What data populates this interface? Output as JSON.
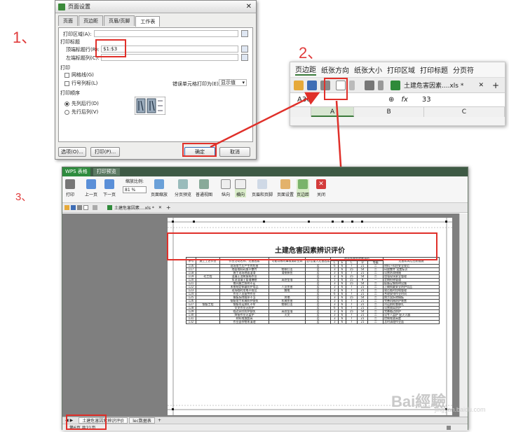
{
  "steps": {
    "s1": "1、",
    "s2": "2、",
    "s3": "3、"
  },
  "dialog": {
    "title": "页面设置",
    "tabs": [
      "页面",
      "页边距",
      "页眉/页脚",
      "工作表"
    ],
    "print_area_label": "打印区域(A):",
    "print_titles_label": "打印标题",
    "top_rows_label": "顶端标题行(R):",
    "top_rows_value": "$1:$3",
    "left_cols_label": "左端标题列(C):",
    "print_section": "打印",
    "gridlines_label": "网格线(G)",
    "rowcol_label": "行号列标(L)",
    "error_label": "错误单元格打印为(E):",
    "error_value": "显示值",
    "order_section": "打印顺序",
    "order_down": "先列后行(D)",
    "order_over": "先行后列(V)",
    "options_btn": "选项(O)...",
    "print_btn": "打印(P)...",
    "ok_btn": "确定",
    "cancel_btn": "取消"
  },
  "toolbar2": {
    "menu": [
      "页边距",
      "纸张方向",
      "纸张大小",
      "打印区域",
      "打印标题",
      "分页符"
    ],
    "doc_tab": "土建危害因素....xls *",
    "cell_ref": "A36",
    "fx": "fx",
    "cell_value": "33",
    "cols": [
      "",
      "A",
      "B",
      "C"
    ]
  },
  "wps": {
    "logo": "WPS 表格",
    "window_tab": "打印预览",
    "ribbon": [
      "打印",
      "上一页",
      "下一页",
      "缩放比例:",
      "页面缩放",
      "分页预览",
      "普通视图",
      "纵向",
      "横向",
      "页眉和页脚",
      "页面设置",
      "页边距",
      "关闭"
    ],
    "zoom": "81 %",
    "doc_tab": "土建危害因素....xls *",
    "sheet_tabs": [
      "土建危害因素辨识评价",
      "lec数据表"
    ],
    "status": "第6页 共21页"
  },
  "report": {
    "title": "土建危害因素辨识评价",
    "headers": [
      "序号",
      "施工工艺作业",
      "作业活动名称、危害因素",
      "可能导致的事故或职业病",
      "是/否重大危害因素",
      "作业条件危险性评价",
      "危害和风险控制措施"
    ],
    "sub_headers": [
      "L",
      "E",
      "C",
      "D",
      "等级"
    ],
    "rows": [
      {
        "n": "116",
        "b": "",
        "c": "现场加工后产生的危害",
        "d": "",
        "e": "否",
        "v": [
          "6",
          "6",
          "7",
          "21",
          "二"
        ],
        "g": "材料下料应安全规范"
      },
      {
        "n": "117",
        "b": "",
        "c": "地面堆料码放不整齐",
        "d": "物体打击",
        "e": "否",
        "v": [
          "3",
          "6",
          "15",
          "54",
          "二"
        ],
        "g": "码放整齐 设置标识"
      },
      {
        "n": "118",
        "b": "",
        "c": "施工现场地面湿滑",
        "d": "滑倒摔伤",
        "e": "否",
        "v": [
          "3",
          "6",
          "7",
          "21",
          "二"
        ],
        "g": "设置防滑措施"
      },
      {
        "n": "119",
        "b": "砼工程",
        "c": "混凝土浇筑振捣作业",
        "d": "",
        "e": "否",
        "v": [
          "3",
          "6",
          "15",
          "54",
          "二"
        ],
        "g": "加强现场安全管理"
      },
      {
        "n": "120",
        "b": "",
        "c": "泵送混凝土管道爆裂",
        "d": "高处坠落",
        "e": "否",
        "v": [
          "1",
          "6",
          "15",
          "9",
          "一"
        ],
        "g": "定期检修管道"
      },
      {
        "n": "121",
        "b": "",
        "c": "夜间施工照明不足",
        "d": "",
        "e": "否",
        "v": [
          "3",
          "6",
          "15",
          "54",
          "二"
        ],
        "g": "配备足够照明设施"
      },
      {
        "n": "122",
        "b": "",
        "c": "未按规定佩戴防护用品",
        "d": "人员伤害",
        "e": "否",
        "v": [
          "3",
          "6",
          "7",
          "21",
          "二"
        ],
        "g": "正确佩戴安全防护用品"
      },
      {
        "n": "123",
        "b": "",
        "c": "现场临时用电不规范",
        "d": "触电",
        "e": "否",
        "v": [
          "3",
          "6",
          "7",
          "21",
          "二"
        ],
        "g": "规范临时用电管理"
      },
      {
        "n": "124",
        "b": "",
        "c": "作业人员疲劳作业",
        "d": "",
        "e": "否",
        "v": [
          "6",
          "6",
          "7",
          "21",
          "二"
        ],
        "g": "合理安排作业时间"
      },
      {
        "n": "125",
        "b": "",
        "c": "模板拆除顺序不当",
        "d": "坍塌",
        "e": "否",
        "v": [
          "3",
          "6",
          "15",
          "54",
          "二"
        ],
        "g": "按方案拆除模板"
      },
      {
        "n": "126",
        "b": "",
        "c": "钢筋加工机械防护缺失",
        "d": "机械伤害",
        "e": "否",
        "v": [
          "3",
          "6",
          "7",
          "21",
          "二"
        ],
        "g": "完善机械防护装置"
      },
      {
        "n": "127",
        "b": "钢筋工程",
        "c": "钢筋吊运绑扎不牢",
        "d": "物体打击",
        "e": "否",
        "v": [
          "3",
          "6",
          "7",
          "21",
          "二"
        ],
        "g": "吊运前检查绑扎"
      },
      {
        "n": "128",
        "b": "",
        "c": "交叉作业无防护",
        "d": "",
        "e": "否",
        "v": [
          "6",
          "6",
          "7",
          "21",
          "二"
        ],
        "g": "设置隔离防护"
      },
      {
        "n": "129",
        "b": "",
        "c": "临边洞口防护缺失",
        "d": "高处坠落",
        "e": "否",
        "v": [
          "3",
          "6",
          "15",
          "54",
          "二"
        ],
        "g": "完善临边防护"
      },
      {
        "n": "130",
        "b": "",
        "c": "焊接作业无监护",
        "d": "火灾",
        "e": "否",
        "v": [
          "3",
          "6",
          "7",
          "21",
          "二"
        ],
        "g": "设专人监护 配灭火器"
      },
      {
        "n": "131",
        "b": "",
        "c": "材料堆放超高",
        "d": "",
        "e": "否",
        "v": [
          "3",
          "6",
          "7",
          "21",
          "二"
        ],
        "g": "控制堆放高度"
      },
      {
        "n": "132",
        "b": "",
        "c": "作业面杂物未清理",
        "d": "",
        "e": "否",
        "v": [
          "3",
          "6",
          "7",
          "21",
          "二"
        ],
        "g": "及时清理作业面"
      }
    ]
  }
}
